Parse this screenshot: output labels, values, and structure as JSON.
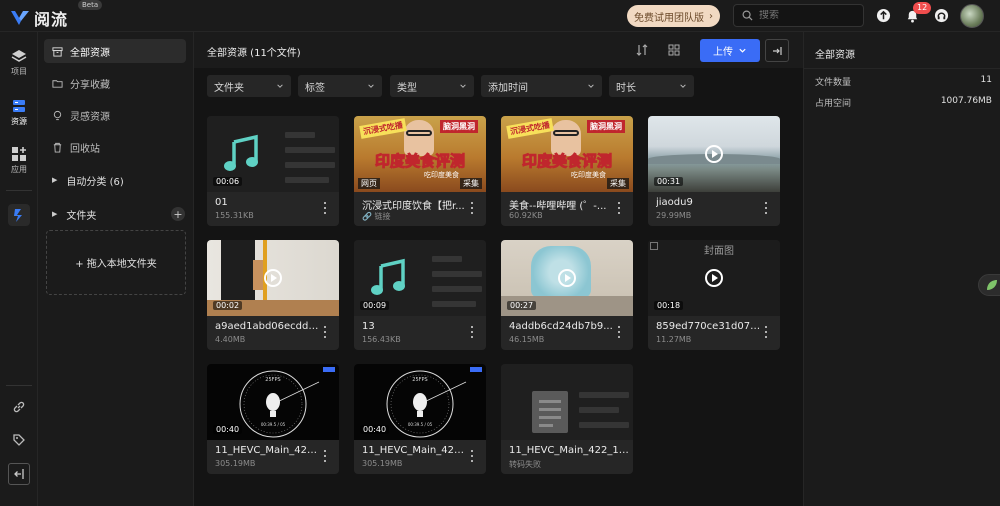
{
  "app": {
    "name": "阅流",
    "beta": "Beta"
  },
  "topbar": {
    "trial_label": "免费试用团队版",
    "search_placeholder": "搜索",
    "notification_count": "12"
  },
  "rail": {
    "items": [
      {
        "label": "项目",
        "icon": "stack-icon"
      },
      {
        "label": "资源",
        "icon": "resource-icon"
      },
      {
        "label": "应用",
        "icon": "apps-icon"
      }
    ]
  },
  "sidebar": {
    "items": [
      {
        "label": "全部资源",
        "icon": "box-icon"
      },
      {
        "label": "分享收藏",
        "icon": "folder-share-icon"
      },
      {
        "label": "灵感资源",
        "icon": "bulb-icon"
      },
      {
        "label": "回收站",
        "icon": "trash-icon"
      }
    ],
    "auto_classify": "自动分类 (6)",
    "folders": "文件夹",
    "dropzone": "+ 拖入本地文件夹"
  },
  "main": {
    "title": "全部资源  (11个文件)",
    "upload_label": "上传",
    "filters": [
      "文件夹",
      "标签",
      "类型",
      "添加时间",
      "时长"
    ]
  },
  "cards": [
    {
      "name": "01",
      "meta": "155.31KB",
      "duration": "00:06"
    },
    {
      "name": "沉浸式印度饮食【把r...",
      "meta": "链接",
      "tag_left": "网页",
      "tag_right": "采集",
      "banner": "印度美食评测",
      "badge_l": "沉浸式吃播",
      "badge_r": "脑洞黑洞",
      "sub": "吃印度美食"
    },
    {
      "name": "美食--哔哩哔哩 (゜-...",
      "meta": "60.92KB",
      "tag_right": "采集",
      "banner": "印度美食评测",
      "badge_l": "沉浸式吃播",
      "badge_r": "脑洞黑洞",
      "sub": "吃印度美食"
    },
    {
      "name": "jiaodu9",
      "meta": "29.99MB",
      "duration": "00:31"
    },
    {
      "name": "a9aed1abd06ecdd1...",
      "meta": "4.40MB",
      "duration": "00:02"
    },
    {
      "name": "13",
      "meta": "156.43KB",
      "duration": "00:09"
    },
    {
      "name": "4addb6cd24db7b9...",
      "meta": "46.15MB",
      "duration": "00:27"
    },
    {
      "name": "859ed770ce31d07d...",
      "meta": "11.27MB",
      "duration": "00:18",
      "cover_label": "封面图"
    },
    {
      "name": "11_HEVC_Main_422...",
      "meta": "305.19MB",
      "duration": "00:40",
      "dial_top": "25FPS",
      "dial_bottom": "00:39.5 / 05"
    },
    {
      "name": "11_HEVC_Main_422...",
      "meta": "305.19MB",
      "duration": "00:40",
      "dial_top": "25FPS",
      "dial_bottom": "00:39.5 / 05"
    },
    {
      "name": "11_HEVC_Main_422_10bi...",
      "meta": "转码失败"
    }
  ],
  "right_panel": {
    "title": "全部资源",
    "rows": [
      {
        "label": "文件数量",
        "value": "11"
      },
      {
        "label": "占用空间",
        "value": "1007.76MB"
      }
    ]
  },
  "colors": {
    "accent": "#3a6cf6",
    "background": "#141414",
    "panel": "#1b1b1b",
    "card": "#262626",
    "trial": "#f1d9c2",
    "badge": "#f04d4d"
  }
}
